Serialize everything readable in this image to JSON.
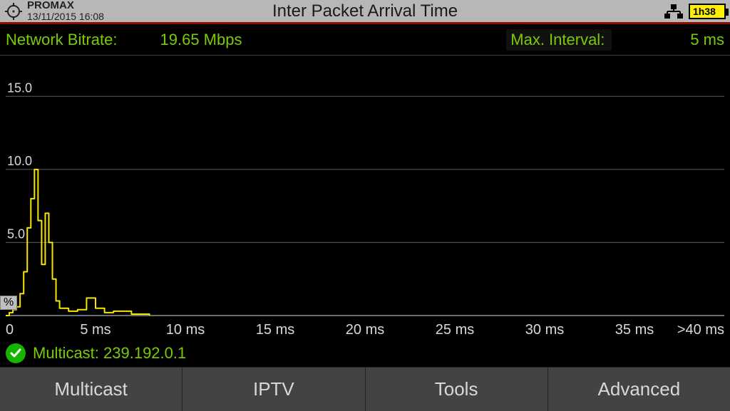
{
  "header": {
    "brand": "PROMAX",
    "timestamp": "13/11/2015 16:08",
    "title": "Inter Packet Arrival Time",
    "battery": "1h38"
  },
  "infobar": {
    "bitrate_label": "Network Bitrate:",
    "bitrate_value": "19.65 Mbps",
    "interval_label": "Max. Interval:",
    "interval_value": "5 ms"
  },
  "status": {
    "text": "Multicast: 239.192.0.1"
  },
  "nav": {
    "items": [
      "Multicast",
      "IPTV",
      "Tools",
      "Advanced"
    ]
  },
  "chart_data": {
    "type": "bar",
    "title": "Inter Packet Arrival Time",
    "xlabel": "",
    "ylabel": "%",
    "ylim": [
      0,
      17.5
    ],
    "y_ticks": [
      5.0,
      10.0,
      15.0
    ],
    "y_tick_labels": [
      "5.0",
      "10.0",
      "15.0"
    ],
    "x_ticks_ms": [
      0,
      5,
      10,
      15,
      20,
      25,
      30,
      35,
      40
    ],
    "x_tick_labels": [
      "0",
      "5 ms",
      "10 ms",
      "15 ms",
      "20 ms",
      "25 ms",
      "30 ms",
      "35 ms",
      ">40 ms"
    ],
    "x": [
      0.0,
      0.2,
      0.4,
      0.6,
      0.8,
      1.0,
      1.2,
      1.4,
      1.6,
      1.8,
      2.0,
      2.2,
      2.4,
      2.6,
      2.8,
      3.0,
      3.5,
      4.0,
      4.5,
      5.0,
      5.5,
      6.0,
      7.0,
      8.0
    ],
    "values": [
      0.0,
      0.2,
      0.4,
      0.6,
      1.5,
      3.0,
      6.0,
      8.0,
      10.0,
      6.5,
      3.5,
      7.0,
      5.0,
      2.5,
      1.0,
      0.5,
      0.3,
      0.4,
      1.2,
      0.5,
      0.2,
      0.3,
      0.1,
      0.0
    ]
  }
}
